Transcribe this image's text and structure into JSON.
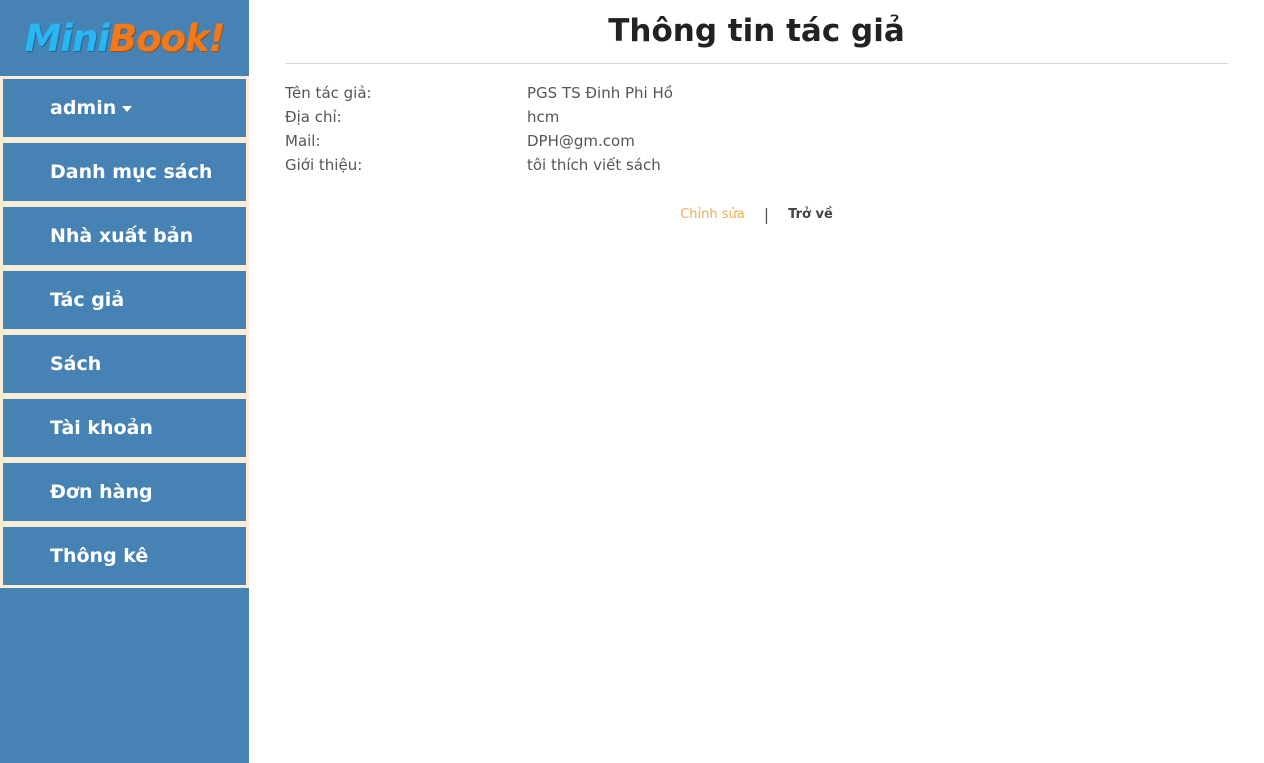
{
  "brand": {
    "part1": "Mini",
    "part2": "Book!",
    "color1": "#2ab6f0",
    "color2": "#f07a1c"
  },
  "sidebar": {
    "background": "#4682b4",
    "gap_color": "#fbeed4",
    "user_menu": {
      "label": "admin",
      "icon": "caret-down-icon"
    },
    "items": [
      {
        "label": "Danh mục sách"
      },
      {
        "label": "Nhà xuất bản"
      },
      {
        "label": "Tác giả"
      },
      {
        "label": "Sách"
      },
      {
        "label": "Tài khoản"
      },
      {
        "label": "Đơn hàng"
      },
      {
        "label": "Thông kê"
      }
    ]
  },
  "main": {
    "title": "Thông tin tác giả",
    "fields": [
      {
        "label": "Tên tác giả:",
        "value": "PGS TS Đinh Phi Hồ"
      },
      {
        "label": "Địa chỉ:",
        "value": "hcm"
      },
      {
        "label": "Mail:",
        "value": "DPH@gm.com"
      },
      {
        "label": "Giới thiệu:",
        "value": "tôi thích viết sách"
      }
    ],
    "actions": {
      "edit": "Chỉnh sửa",
      "separator": "|",
      "back": "Trở về"
    }
  }
}
